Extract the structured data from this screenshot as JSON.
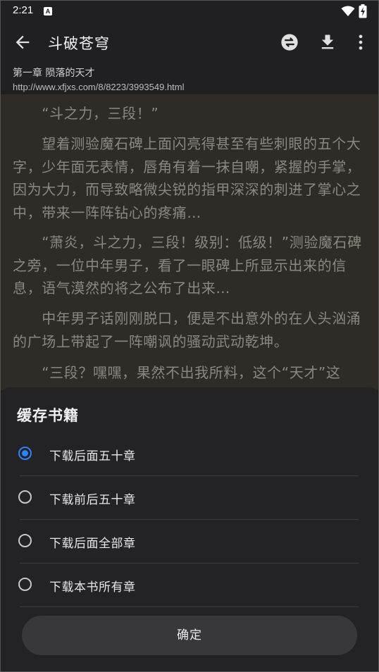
{
  "status_bar": {
    "time": "2:21",
    "notification_letter": "A"
  },
  "toolbar": {
    "title": "斗破苍穹",
    "icons": [
      "back-arrow-icon",
      "change-source-icon",
      "download-icon",
      "more-vert-icon"
    ]
  },
  "chapter": {
    "title": "第一章 陨落的天才",
    "url": "http://www.xfjxs.com/8/8223/3993549.html"
  },
  "content": {
    "paragraphs": [
      "　　“斗之力，三段！”",
      "　　望着测验魔石碑上面闪亮得甚至有些刺眼的五个大字，少年面无表情，唇角有着一抹自嘲，紧握的手掌，因为大力，而导致略微尖锐的指甲深深的刺进了掌心之中，带来一阵阵钻心的疼痛…",
      "　　“萧炎，斗之力，三段！级别：低级！”测验魔石碑之旁，一位中年男子，看了一眼碑上所显示出来的信息，语气漠然的将之公布了出来…",
      "　　中年男子话刚刚脱口，便是不出意外的在人头汹涌的广场上带起了一阵嘲讽的骚动武动乾坤。",
      "　　“三段？嘿嘿，果然不出我所料，这个“天才”这"
    ]
  },
  "dialog": {
    "title": "缓存书籍",
    "options": [
      {
        "label": "下载后面五十章",
        "selected": true
      },
      {
        "label": "下载前后五十章",
        "selected": false
      },
      {
        "label": "下载后面全部章",
        "selected": false
      },
      {
        "label": "下载本书所有章",
        "selected": false
      }
    ],
    "confirm_label": "确定"
  },
  "colors": {
    "toolbar_bg": "#202022",
    "reading_bg": "#2f2b27",
    "reading_text": "#8b8781",
    "sheet_bg": "#232326",
    "accent": "#2f81f7"
  }
}
